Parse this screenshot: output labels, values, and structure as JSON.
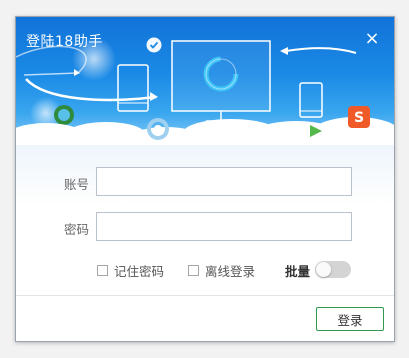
{
  "window": {
    "title": "登陆18助手",
    "close_glyph": "×"
  },
  "banner": {
    "icons": [
      "check-badge-icon",
      "monitor-icon",
      "phone-icon",
      "tablet-icon",
      "sogou-icon",
      "qq-browser-icon",
      "ie-icon"
    ],
    "colors": {
      "sky_top": "#1273d8",
      "sky_bottom": "#8ccdf6"
    }
  },
  "form": {
    "account_label": "账号",
    "account_value": "",
    "password_label": "密码",
    "password_value": "",
    "remember_label": "记住密码",
    "remember_checked": false,
    "offline_label": "离线登录",
    "offline_checked": false,
    "bulk_label": "批量",
    "bulk_on": false
  },
  "footer": {
    "login_label": "登录",
    "accent": "#2f9b4e"
  }
}
